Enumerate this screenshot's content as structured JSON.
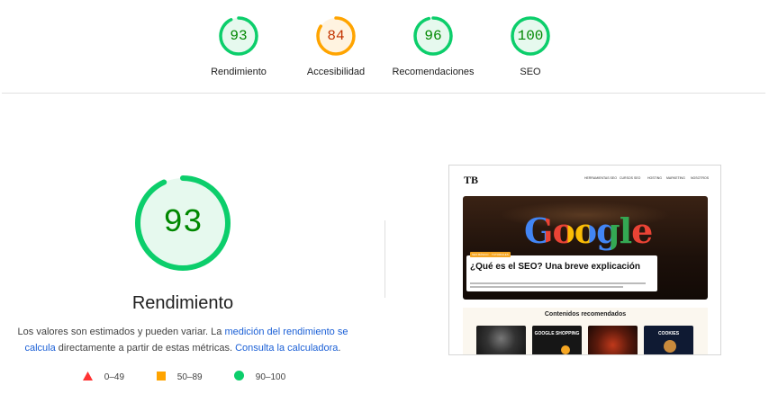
{
  "colors": {
    "pass": "#0cce6b",
    "pass_text": "#008800",
    "pass_bg": "#e6f9ee",
    "average": "#ffa400",
    "average_text": "#c33300",
    "average_bg": "#fff3e0",
    "fail": "#ff3333"
  },
  "scores": [
    {
      "value": "93",
      "label": "Rendimiento",
      "status": "pass"
    },
    {
      "value": "84",
      "label": "Accesibilidad",
      "status": "average"
    },
    {
      "value": "96",
      "label": "Recomendaciones",
      "status": "pass"
    },
    {
      "value": "100",
      "label": "SEO",
      "status": "pass"
    }
  ],
  "performance": {
    "score": "93",
    "title": "Rendimiento",
    "desc_part1": "Los valores son estimados y pueden variar. La ",
    "desc_link1": "medición del rendimiento se calcula",
    "desc_part2": " directamente a partir de estas métricas. ",
    "desc_link2": "Consulta la calculadora",
    "desc_part3": "."
  },
  "legend": [
    {
      "shape": "triangle-icon",
      "range": "0–49"
    },
    {
      "shape": "square-icon",
      "range": "50–89"
    },
    {
      "shape": "circle-icon",
      "range": "90–100"
    }
  ],
  "screenshot": {
    "logo": "TB",
    "nav": [
      "HERRAMIENTAS SEO",
      "CURSOS",
      "SEO",
      "HOSTING",
      "MARKETING",
      "NOSOTROS"
    ],
    "hero_word": "Google",
    "tags": [
      "SEO BÁSICO",
      "TUTORIALES"
    ],
    "hero_title": "¿Qué es el SEO? Una breve explicación",
    "section_title": "Contenidos recomendados",
    "tiles": [
      "",
      "GOOGLE SHOPPING",
      "",
      "COOKIES"
    ]
  }
}
